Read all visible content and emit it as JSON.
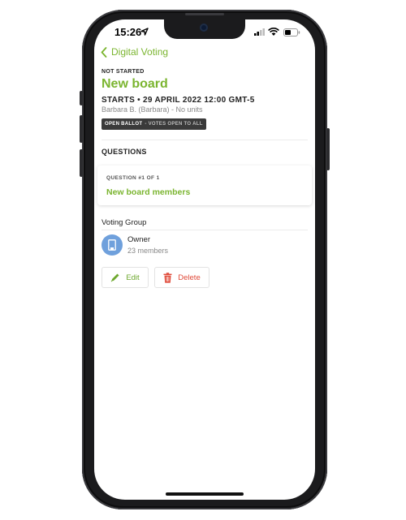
{
  "status_bar": {
    "time": "15:26"
  },
  "nav": {
    "back_label": "Digital Voting"
  },
  "board": {
    "status": "NOT STARTED",
    "title": "New board",
    "starts": "STARTS • 29 APRIL 2022 12:00 GMT-5",
    "owner_line": "Barbara B. (Barbara) - No units",
    "ballot_type": "OPEN BALLOT",
    "ballot_note": "- VOTES OPEN TO ALL"
  },
  "questions": {
    "heading": "QUESTIONS",
    "items": [
      {
        "number": "QUESTION #1 OF 1",
        "name": "New board members"
      }
    ]
  },
  "voting_group": {
    "label": "Voting Group",
    "name": "Owner",
    "members": "23 members"
  },
  "actions": {
    "edit_label": "Edit",
    "delete_label": "Delete"
  },
  "colors": {
    "accent": "#7bb530",
    "danger": "#e04b3a",
    "avatar": "#6fa0dc"
  }
}
